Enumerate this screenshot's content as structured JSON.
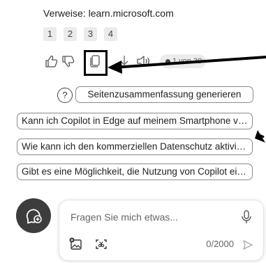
{
  "references": {
    "label": "Verweise: learn.microsoft.com",
    "chips": [
      "1",
      "2",
      "3",
      "4"
    ]
  },
  "actions": {
    "icons": [
      "thumbs-up-icon",
      "thumbs-down-icon",
      "copy-icon",
      "download-icon",
      "read-aloud-icon"
    ],
    "duration_text": "1 von 30"
  },
  "summary_chip": {
    "label": "Seitenzusammenfassung generieren",
    "icon": "help-circle-icon"
  },
  "suggestions": [
    "Kann ich Copilot in Edge auf meinem Smartphone verwenden?",
    "Wie kann ich den kommerziellen Datenschutz aktivieren?",
    "Gibt es eine Möglichkeit, die Nutzung von Copilot einzuschränken?"
  ],
  "composer": {
    "placeholder": "Fragen Sie mich etwas...",
    "counter": "0/2000",
    "icons": [
      "microphone-icon",
      "image-add-icon",
      "screenshot-icon",
      "send-icon"
    ]
  },
  "new_chat": {
    "icon": "new-chat-icon"
  },
  "colors": {
    "chip_border": "#8a8a8a",
    "highlight": "#000000",
    "new_chat_bg": "#3d3d3d"
  }
}
